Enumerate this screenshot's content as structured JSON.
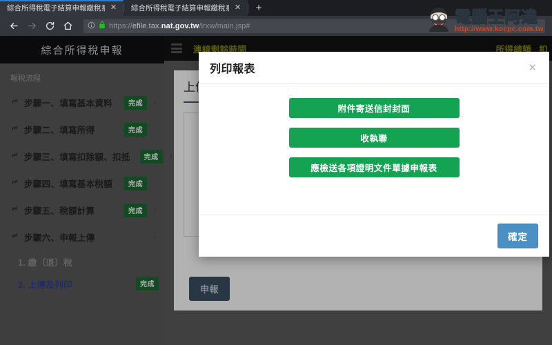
{
  "browser": {
    "tabs": [
      {
        "title": "綜合所得稅電子結算申報繳稅系統",
        "close_label": "✕",
        "active": true
      },
      {
        "title": "綜合所得稅電子結算申報繳稅系統",
        "close_label": "✕",
        "active": false
      }
    ],
    "new_tab_label": "+",
    "nav": {
      "back": "back-arrow",
      "forward": "forward-arrow",
      "reload": "reload-arrow",
      "home": "home"
    },
    "url": {
      "scheme": "https://",
      "prefix": "efile.tax.",
      "domain": "nat.gov.tw",
      "path": "/irxw/main.jsp#",
      "full": "https://efile.tax.nat.gov.tw/irxw/main.jsp#"
    }
  },
  "sidebar": {
    "title": "綜合所得稅申報",
    "flow_label": "報稅流程",
    "steps": [
      {
        "label": "步驟一、填寫基本資料",
        "badge": "完成",
        "chevron": "‹"
      },
      {
        "label": "步驟二、填寫所得",
        "badge": "完成",
        "chevron": ""
      },
      {
        "label": "步驟三、填寫扣除額、扣抵",
        "badge": "完成",
        "chevron": "‹"
      },
      {
        "label": "步驟四、填寫基本稅額",
        "badge": "完成",
        "chevron": ""
      },
      {
        "label": "步驟五、稅額計算",
        "badge": "完成",
        "chevron": "‹"
      },
      {
        "label": "步驟六、申報上傳",
        "badge": "",
        "chevron": "‹"
      }
    ],
    "substeps": [
      {
        "label": "1. 繳（退）稅",
        "badge": "",
        "state": "muted"
      },
      {
        "label": "2. 上傳及列印",
        "badge": "完成",
        "state": "active"
      }
    ]
  },
  "topbar": {
    "menu_label": "menu",
    "left_label": "連線剩餘時間",
    "right_labels": [
      "所得總額",
      "扣"
    ]
  },
  "main_panel": {
    "heading": "上傳",
    "button_label": "申報"
  },
  "modal": {
    "title": "列印報表",
    "close_label": "✕",
    "buttons": [
      "附件寄送信封封面",
      "收執聯",
      "應檢送各項證明文件單據申報表"
    ],
    "confirm_label": "確定"
  },
  "watermark": {
    "text": "電腦王阿達",
    "url": "http://www.kocpc.com.tw"
  },
  "colors": {
    "accent_green": "#13a353",
    "badge_green": "#1a6b32",
    "confirm_blue": "#4a90c4",
    "topbar_gold": "#8a8a12",
    "active_link_blue": "#2b3fa0"
  }
}
